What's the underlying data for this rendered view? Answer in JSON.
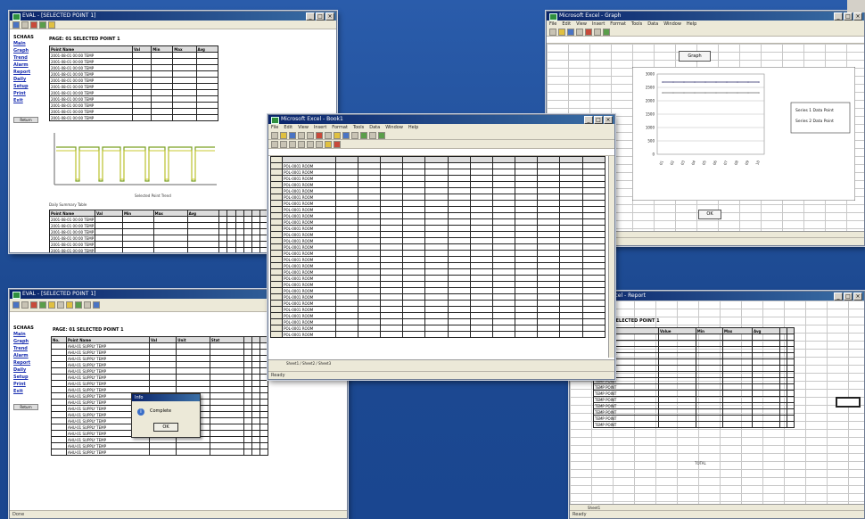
{
  "desktop": {
    "background": "#1f4f9a"
  },
  "window_tl": {
    "title": "EVAL - [SELECTED POINT 1]",
    "sidebar_brand": "SCHAAS",
    "sidebar_links": [
      "Main",
      "Graph",
      "Trend",
      "Alarm",
      "Report",
      "Daily",
      "Setup",
      "Print",
      "Exit"
    ],
    "sidebar_button": "Return",
    "heading": "PAGE: 01 SELECTED POINT 1",
    "columns": [
      "Point Name",
      "Val",
      "Min",
      "Max",
      "Avg"
    ],
    "row_label": "2001-08-01 00:00 TEMP",
    "chart_caption": "Selected Point Trend",
    "lower_caption": "Daily Summary Table"
  },
  "window_center": {
    "title": "Microsoft Excel - Book1",
    "menu": [
      "File",
      "Edit",
      "View",
      "Insert",
      "Format",
      "Tools",
      "Data",
      "Window",
      "Help"
    ],
    "row_label": "POL-0001 ROOM",
    "status": "Ready",
    "sheet_tabs": "Sheet1 / Sheet2 / Sheet3"
  },
  "window_tr": {
    "title": "Microsoft Excel - Graph",
    "button": "Graph",
    "legend": [
      "Series 1 Data Point",
      "Series 2 Data Point"
    ],
    "y_ticks": [
      "3000",
      "2500",
      "2000",
      "1500",
      "1000",
      "500",
      "0"
    ],
    "x_ticks": [
      "01",
      "02",
      "03",
      "04",
      "05",
      "06",
      "07",
      "08",
      "09",
      "10"
    ],
    "sub_button": "OK",
    "chart_data": {
      "type": "line",
      "x": [
        "01",
        "02",
        "03",
        "04",
        "05",
        "06",
        "07",
        "08",
        "09",
        "10"
      ],
      "series": [
        {
          "values": [
            2700,
            2700,
            2700,
            2700,
            2700,
            2700,
            2700,
            2700,
            2700,
            2700
          ]
        },
        {
          "values": [
            2300,
            2300,
            2300,
            2300,
            2300,
            2300,
            2300,
            2300,
            2300,
            2300
          ]
        }
      ],
      "ylim": [
        0,
        3000
      ],
      "grid": true,
      "legend": "right"
    }
  },
  "window_bl": {
    "title": "EVAL - [SELECTED POINT 1]",
    "sidebar_brand": "SCHAAS",
    "sidebar_links": [
      "Main",
      "Graph",
      "Trend",
      "Alarm",
      "Report",
      "Daily",
      "Setup",
      "Print",
      "Exit"
    ],
    "sidebar_button": "Return",
    "heading": "PAGE: 01 SELECTED POINT 1",
    "columns": [
      "No.",
      "Point Name",
      "Val",
      "Unit",
      "Stat"
    ],
    "row_label": "AHU-01 SUPPLY TEMP",
    "dialog": {
      "title": "Info",
      "message": "Complete",
      "ok": "OK"
    },
    "status": "Done"
  },
  "window_br": {
    "title": "Microsoft Excel - Report",
    "heading": "SELECTED POINT 1",
    "columns": [
      "Item",
      "Value",
      "Min",
      "Max",
      "Avg"
    ],
    "row_label": "TEMP POINT",
    "footer": "TOTAL",
    "status": "Ready"
  }
}
